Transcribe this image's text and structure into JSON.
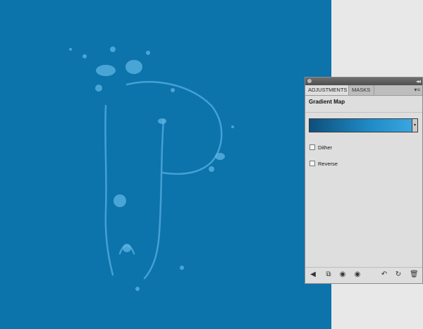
{
  "panel": {
    "tabs": [
      {
        "label": "ADJUSTMENTS"
      },
      {
        "label": "MASKS"
      }
    ],
    "collapse_glyph": "◂◂",
    "menu_glyph": "▾≡",
    "title": "Gradient Map",
    "gradient": {
      "colors": [
        "#0d4f7d",
        "#1f8cc7",
        "#3aa6e0"
      ],
      "drop_glyph": "▾"
    },
    "options": [
      {
        "label": "Dither",
        "checked": false
      },
      {
        "label": "Reverse",
        "checked": false
      }
    ],
    "footer_icons": [
      {
        "name": "back-arrow-icon",
        "glyph": "◀"
      },
      {
        "name": "expanded-view-icon",
        "glyph": "⧉"
      },
      {
        "name": "clip-layer-icon",
        "glyph": "◉"
      },
      {
        "name": "visibility-eye-icon",
        "glyph": "◉"
      },
      {
        "name": "view-previous-icon",
        "glyph": "↶"
      },
      {
        "name": "reset-icon",
        "glyph": "↻"
      },
      {
        "name": "trash-icon",
        "glyph": "🗑"
      }
    ]
  },
  "colors": {
    "canvas": "#0c73ab",
    "artwork": "#5fb6e6"
  }
}
